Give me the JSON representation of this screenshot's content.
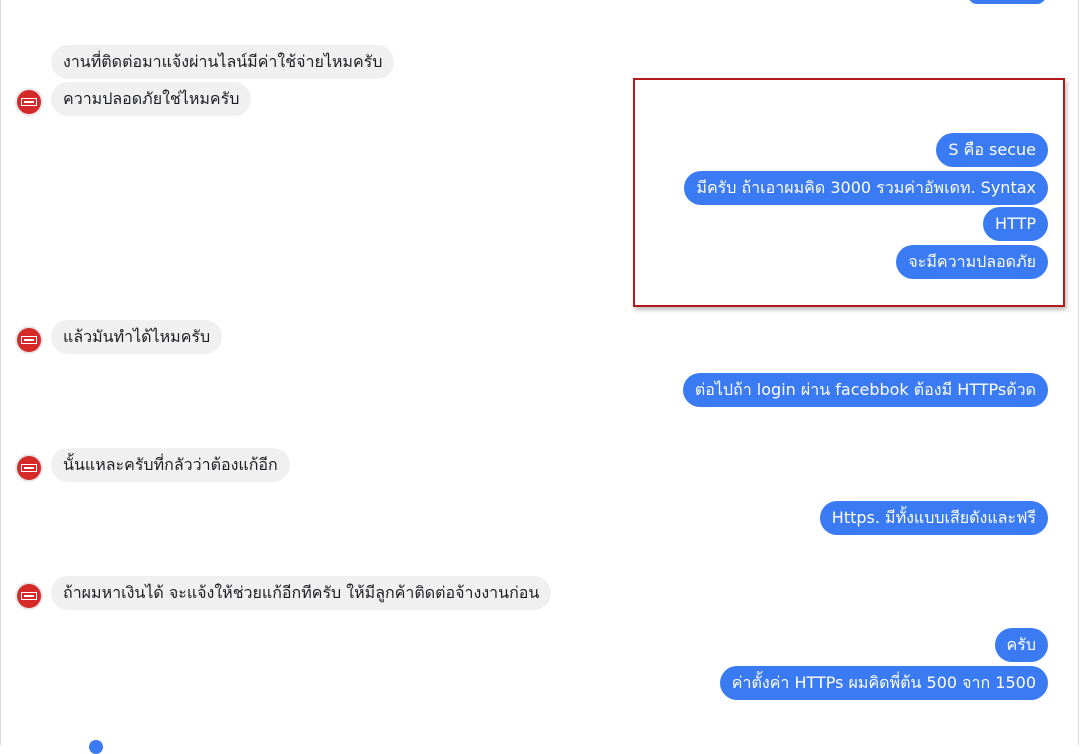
{
  "conversation": {
    "incoming": [
      {
        "text": "งานที่ติดต่อมาแจ้งผ่านไลน์มีค่าใช้จ่ายไหมครับ"
      },
      {
        "text": "ความปลอดภัยใช่ไหมครับ"
      },
      {
        "text": "แล้วมันทำได้ไหมครับ"
      },
      {
        "text": "นั้นแหละครับที่กลัวว่าต้องแก้อีก"
      },
      {
        "text": "ถ้าผมหาเงินได้ จะแจ้งให้ช่วยแก้อีกทีครับ ให้มีลูกค้าติดต่อจ้างงานก่อน"
      }
    ],
    "outgoing": [
      {
        "text": "S คือ secue"
      },
      {
        "text": "มีครับ ถ้าเอาผมคิด 3000 รวมค่าอัพเดท. Syntax"
      },
      {
        "text": "HTTP"
      },
      {
        "text": "จะมีความปลอดภัย"
      },
      {
        "text": "ต่อไปถ้า login ผ่าน facebbok ต้องมี HTTPsด้วด"
      },
      {
        "text": "Https. มีทั้งแบบเสียดังและฟรี"
      },
      {
        "text": "ครับ"
      },
      {
        "text": "ค่าตั้งค่า HTTPs ผมคิดพี่ต้น 500 จาก 1500"
      }
    ]
  },
  "colors": {
    "incoming_bubble": "#f1f0f0",
    "outgoing_bubble": "#3a7af2",
    "highlight_border": "#b31a1a",
    "avatar": "#d6292a"
  },
  "icons": {
    "avatar": "company-logo-avatar"
  }
}
